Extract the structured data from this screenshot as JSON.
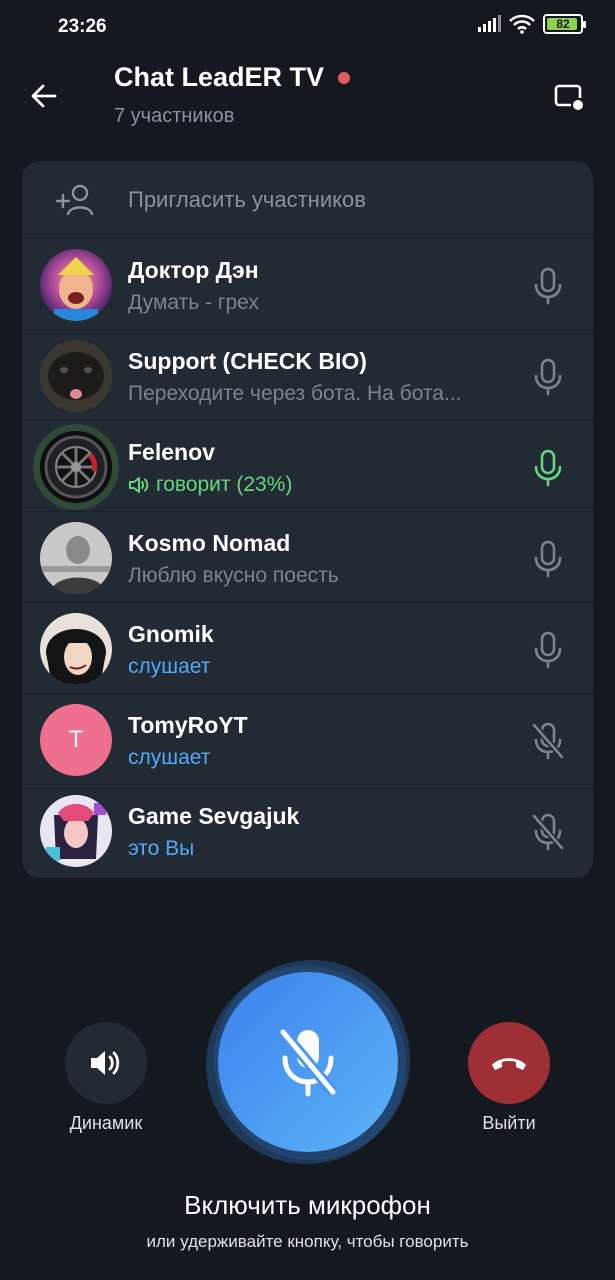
{
  "status_bar": {
    "time": "23:26",
    "battery": "82"
  },
  "header": {
    "title": "Chat LeadER TV",
    "subtitle": "7 участников"
  },
  "invite": {
    "label": "Пригласить участников"
  },
  "participants": [
    {
      "name": "Доктор Дэн",
      "status": "Думать - грех",
      "status_color": "gray",
      "mic": "on"
    },
    {
      "name": "Support (CHECK BIO)",
      "status": "Переходите через бота. На бота...",
      "status_color": "gray",
      "mic": "on"
    },
    {
      "name": "Felenov",
      "status": "говорит (23%)",
      "status_color": "green",
      "mic": "speaking"
    },
    {
      "name": "Kosmo Nomad",
      "status": "Люблю вкусно поесть",
      "status_color": "gray",
      "mic": "on"
    },
    {
      "name": "Gnomik",
      "status": "слушает",
      "status_color": "blue",
      "mic": "on"
    },
    {
      "name": "TomyRoYT",
      "status": "слушает",
      "status_color": "blue",
      "mic": "muted",
      "avatar_letter": "T",
      "avatar_color": "#ef6f8f"
    },
    {
      "name": "Game Sevgajuk",
      "status": "это Вы",
      "status_color": "blue",
      "mic": "muted"
    }
  ],
  "controls": {
    "speaker_label": "Динамик",
    "leave_label": "Выйти",
    "hint_title": "Включить микрофон",
    "hint_sub": "или удерживайте кнопку, чтобы говорить"
  },
  "colors": {
    "background": "#14181f",
    "panel": "#222a33",
    "accent_blue": "#53a9f5",
    "speaking_green": "#66d67e",
    "leave_red": "#9e2f34",
    "record_dot": "#e35a5e"
  }
}
